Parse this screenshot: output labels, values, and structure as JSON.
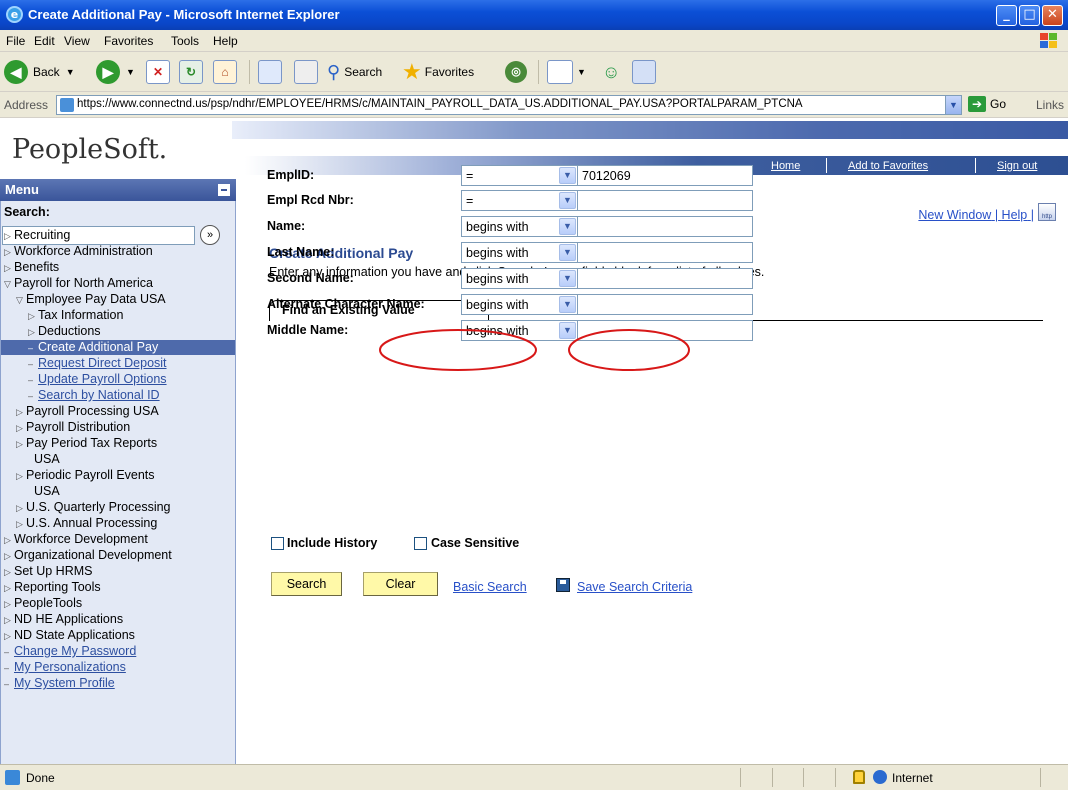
{
  "window": {
    "title": "Create Additional Pay - Microsoft Internet Explorer",
    "controls": {
      "minimize": "_",
      "maximize": "□",
      "close": "✕"
    }
  },
  "menubar": [
    "File",
    "Edit",
    "View",
    "Favorites",
    "Tools",
    "Help"
  ],
  "toolbar": {
    "back": "Back",
    "search": "Search",
    "favorites": "Favorites"
  },
  "address": {
    "label": "Address",
    "url": "https://www.connectnd.us/psp/ndhr/EMPLOYEE/HRMS/c/MAINTAIN_PAYROLL_DATA_US.ADDITIONAL_PAY.USA?PORTALPARAM_PTCNA",
    "go": "Go",
    "links": "Links"
  },
  "banner": {
    "logo": "PeopleSoft.",
    "nav": [
      "Home",
      "Add to Favorites",
      "Sign out"
    ]
  },
  "menu": {
    "header": "Menu",
    "search_label": "Search:",
    "search_value": "",
    "go_glyph": "»",
    "items": [
      {
        "label": "Recruiting",
        "icon": "▷"
      },
      {
        "label": "Workforce Administration",
        "icon": "▷"
      },
      {
        "label": "Benefits",
        "icon": "▷"
      },
      {
        "label": "Payroll for North America",
        "icon": "▽"
      },
      {
        "label": "Employee Pay Data USA",
        "icon": "▽"
      },
      {
        "label": "Tax Information",
        "icon": "▷"
      },
      {
        "label": "Deductions",
        "icon": "▷"
      },
      {
        "label": "Create Additional Pay",
        "icon": "–"
      },
      {
        "label": "Request Direct Deposit",
        "icon": "–"
      },
      {
        "label": "Update Payroll Options",
        "icon": "–"
      },
      {
        "label": "Search by National ID",
        "icon": "–"
      },
      {
        "label": "Payroll Processing USA",
        "icon": "▷"
      },
      {
        "label": "Payroll Distribution",
        "icon": "▷"
      },
      {
        "label": "Pay Period Tax Reports",
        "icon": "▷"
      },
      {
        "label": "USA",
        "icon": ""
      },
      {
        "label": "Periodic Payroll Events",
        "icon": "▷"
      },
      {
        "label": "USA",
        "icon": ""
      },
      {
        "label": "U.S. Quarterly Processing",
        "icon": "▷"
      },
      {
        "label": "U.S. Annual Processing",
        "icon": "▷"
      },
      {
        "label": "Workforce Development",
        "icon": "▷"
      },
      {
        "label": "Organizational Development",
        "icon": "▷"
      },
      {
        "label": "Set Up HRMS",
        "icon": "▷"
      },
      {
        "label": "Reporting Tools",
        "icon": "▷"
      },
      {
        "label": "PeopleTools",
        "icon": "▷"
      },
      {
        "label": "ND HE Applications",
        "icon": "▷"
      },
      {
        "label": "ND State Applications",
        "icon": "▷"
      },
      {
        "label": "Change My Password",
        "icon": "–"
      },
      {
        "label": "My Personalizations",
        "icon": "–"
      },
      {
        "label": "My System Profile",
        "icon": "–"
      }
    ]
  },
  "main": {
    "new_window": "New Window",
    "help": "Help",
    "separator": "|",
    "http_icon": "http",
    "title": "Create Additional Pay",
    "instructions": "Enter any information you have and click Search. Leave fields blank for a list of all values.",
    "tab": "Find an Existing Value",
    "fields": [
      {
        "label": "EmplID:",
        "operator": "=",
        "value": "7012069"
      },
      {
        "label": "Empl Rcd Nbr:",
        "operator": "=",
        "value": ""
      },
      {
        "label": "Name:",
        "operator": "begins with",
        "value": ""
      },
      {
        "label": "Last Name:",
        "operator": "begins with",
        "value": ""
      },
      {
        "label": "Second Name:",
        "operator": "begins with",
        "value": ""
      },
      {
        "label": "Alternate Character Name:",
        "operator": "begins with",
        "value": ""
      },
      {
        "label": "Middle Name:",
        "operator": "begins with",
        "value": ""
      }
    ],
    "include_history": "Include History",
    "case_sensitive": "Case Sensitive",
    "search_button": "Search",
    "clear_button": "Clear",
    "basic_search": "Basic Search",
    "save_search": "Save Search Criteria",
    "annotation_color": "#d81818"
  },
  "status": {
    "text": "Done",
    "zone": "Internet"
  }
}
